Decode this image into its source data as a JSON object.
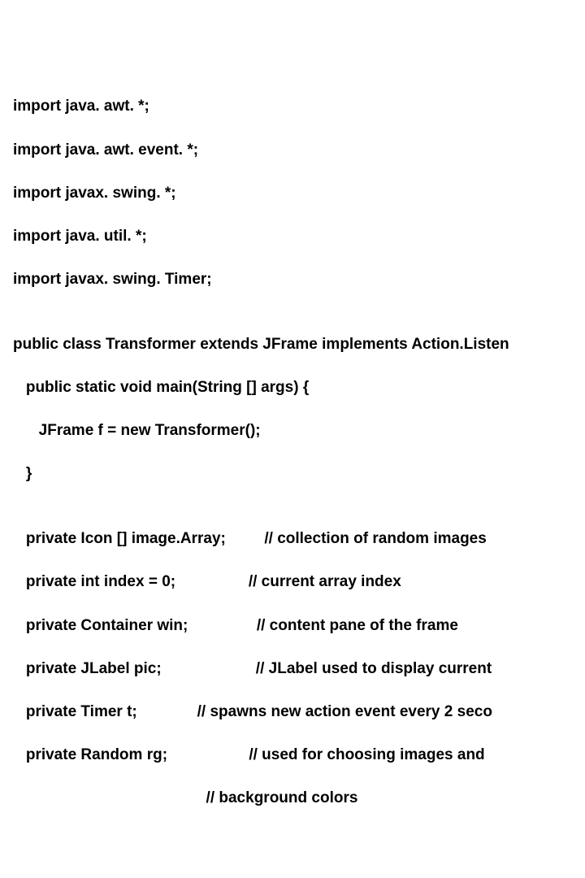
{
  "lines": [
    "import java. awt. *;",
    "import java. awt. event. *;",
    "import javax. swing. *;",
    "import java. util. *;",
    "import javax. swing. Timer;",
    "",
    "public class Transformer extends JFrame implements Action.Listen",
    "   public static void main(String [] args) {",
    "      JFrame f = new Transformer();",
    "   }",
    "",
    "   private Icon [] image.Array;         // collection of random images",
    "   private int index = 0;                 // current array index",
    "   private Container win;                // content pane of the frame",
    "   private JLabel pic;                      // JLabel used to display current",
    "   private Timer t;              // spawns new action event every 2 seco",
    "   private Random rg;                   // used for choosing images and",
    "                                             // background colors"
  ]
}
